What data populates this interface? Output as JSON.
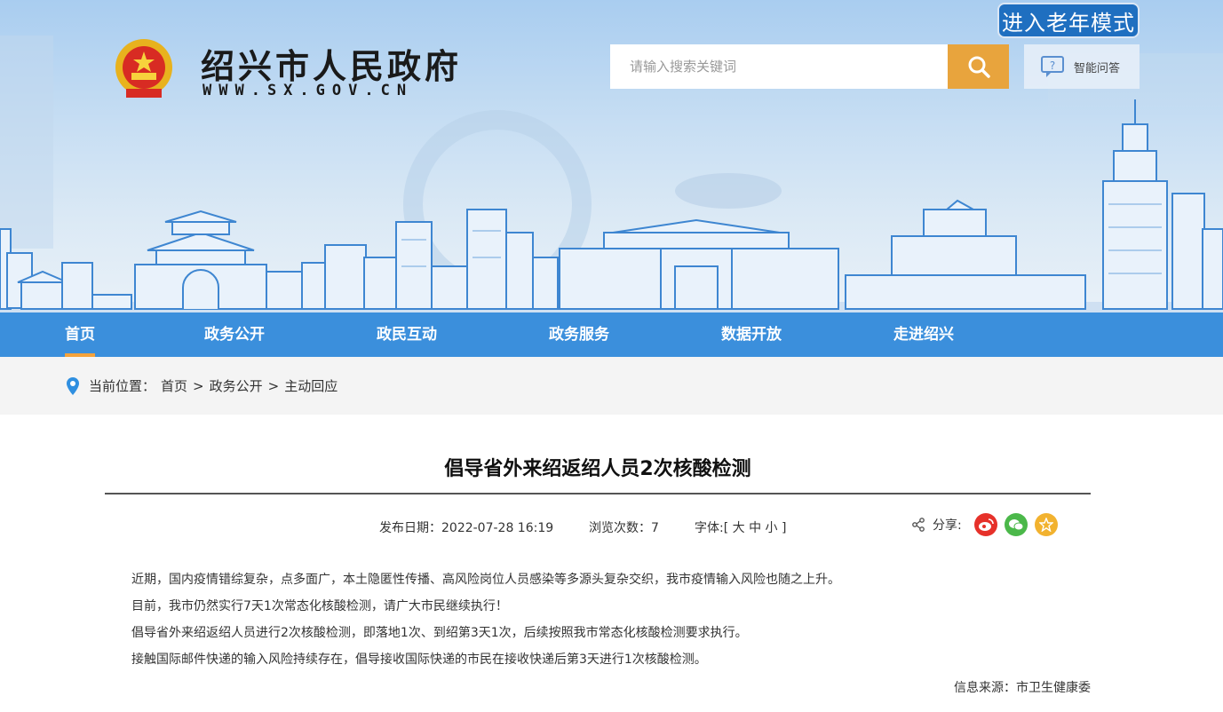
{
  "header": {
    "site_title": "绍兴市人民政府",
    "site_url": "WWW.SX.GOV.CN",
    "elder_mode": "进入老年模式",
    "search_placeholder": "请输入搜索关键词",
    "smart_qa": "智能问答"
  },
  "nav": {
    "items": [
      {
        "label": "首页",
        "active": true
      },
      {
        "label": "政务公开"
      },
      {
        "label": "政民互动"
      },
      {
        "label": "政务服务"
      },
      {
        "label": "数据开放"
      },
      {
        "label": "走进绍兴"
      }
    ]
  },
  "breadcrumb": {
    "prefix": "当前位置：",
    "items": [
      "首页",
      "政务公开",
      "主动回应"
    ],
    "separator": ">"
  },
  "article": {
    "title": "倡导省外来绍返绍人员2次核酸检测",
    "publish_label": "发布日期：",
    "publish_date": "2022-07-28 16:19",
    "views_label": "浏览次数：",
    "views": "7",
    "font_label": "字体:[ 大 中 小 ]",
    "share_label": "分享:",
    "paragraphs": [
      "近期，国内疫情错综复杂，点多面广，本土隐匿性传播、高风险岗位人员感染等多源头复杂交织，我市疫情输入风险也随之上升。",
      "目前，我市仍然实行7天1次常态化核酸检测，请广大市民继续执行！",
      "倡导省外来绍返绍人员进行2次核酸检测，即落地1次、到绍第3天1次，后续按照我市常态化核酸检测要求执行。",
      "接触国际邮件快递的输入风险持续存在，倡导接收国际快递的市民在接收快递后第3天进行1次核酸检测。"
    ],
    "source": "信息来源：市卫生健康委"
  },
  "colors": {
    "nav_bg": "#3b8fdc",
    "nav_active": "#f4a23b",
    "search_btn": "#e8a43d",
    "elder_btn": "#1f6fc0",
    "weibo": "#e6312a",
    "wechat": "#4bb84a",
    "favorite": "#f2b22f"
  },
  "icons": {
    "emblem": "national-emblem-icon",
    "search": "search-icon",
    "qa": "chat-question-icon",
    "location": "location-pin-icon",
    "share": "share-icon",
    "weibo": "weibo-icon",
    "wechat": "wechat-icon",
    "favorite": "favorite-star-icon"
  }
}
